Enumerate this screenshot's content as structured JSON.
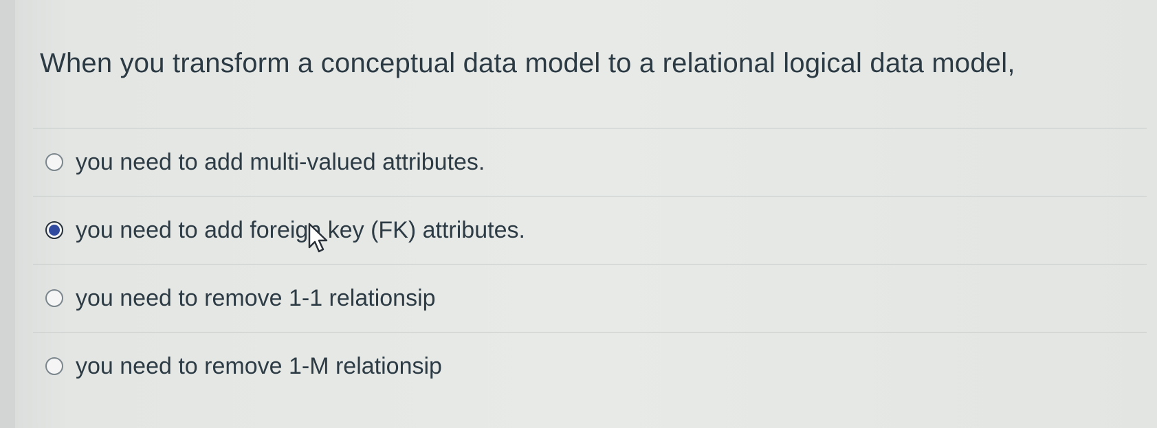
{
  "question": {
    "text": "When you transform a conceptual data model to a relational logical data model,"
  },
  "answers": [
    {
      "label": "you need to add multi-valued attributes.",
      "selected": false
    },
    {
      "label": "you need to add foreign key (FK) attributes.",
      "selected": true
    },
    {
      "label": "you need to remove 1-1 relationsip",
      "selected": false
    },
    {
      "label": "you need to remove 1-M relationsip",
      "selected": false
    }
  ],
  "colors": {
    "text": "#2d3b45",
    "selected_radio": "#2f4a9e",
    "divider": "#c6cac8"
  },
  "icons": {
    "cursor": "mouse-pointer-icon"
  }
}
